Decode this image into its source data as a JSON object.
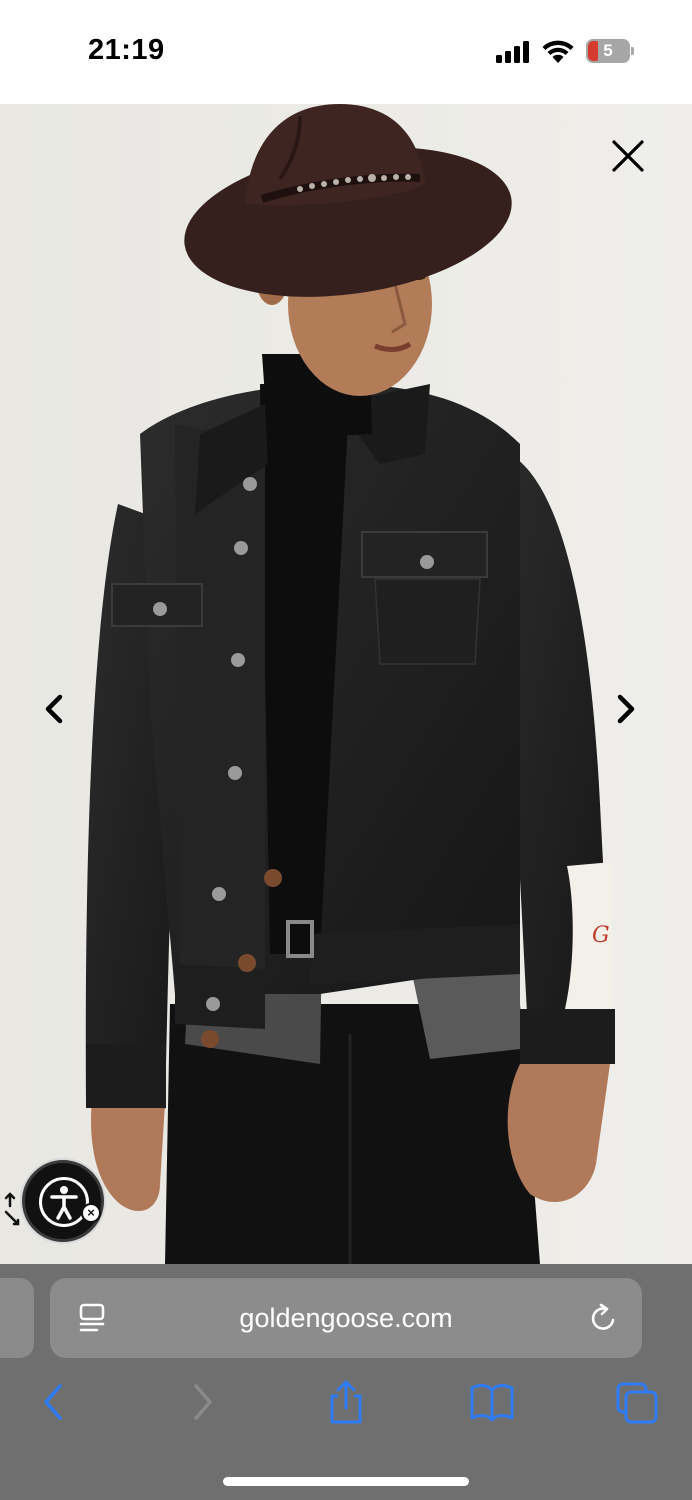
{
  "status_bar": {
    "time": "21:19",
    "battery_level": "5",
    "battery_color": "#d63b30"
  },
  "product_viewer": {
    "background_color": "#ebeae6",
    "close_icon": "close-icon",
    "prev_icon": "chevron-left-icon",
    "next_icon": "chevron-right-icon"
  },
  "accessibility_widget": {
    "icon": "accessibility-person-icon",
    "badge": "×"
  },
  "browser": {
    "url": "goldengoose.com",
    "reader_icon": "reader-icon",
    "reload_icon": "reload-icon",
    "toolbar": {
      "back_icon": "back-icon",
      "forward_icon": "forward-icon",
      "share_icon": "share-icon",
      "bookmarks_icon": "book-icon",
      "tabs_icon": "tabs-icon",
      "accent_color": "#2f7bf5"
    }
  }
}
